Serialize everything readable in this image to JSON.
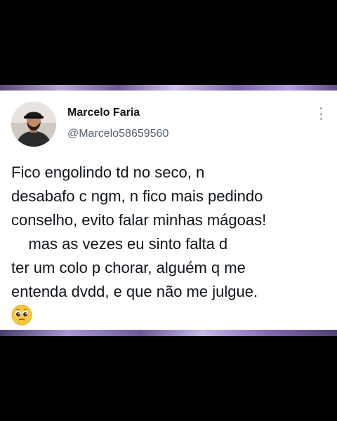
{
  "tweet": {
    "author_name": "Marcelo Faria",
    "handle": "@Marcelo58659560",
    "lines": [
      "Fico engolindo td no seco, n",
      "desabafo c ngm, n fico mais pedindo",
      "conselho, evito falar minhas mágoas!",
      "    mas as vezes eu sinto falta d",
      "ter um colo p chorar, alguém q me",
      "entenda dvdd, e que não me julgue."
    ],
    "emoji_icon": "pleading-face-icon",
    "more_icon": "more-options-icon"
  },
  "colors": {
    "name": "#0f1419",
    "handle": "#536471",
    "background": "#000000",
    "card": "#ffffff"
  }
}
